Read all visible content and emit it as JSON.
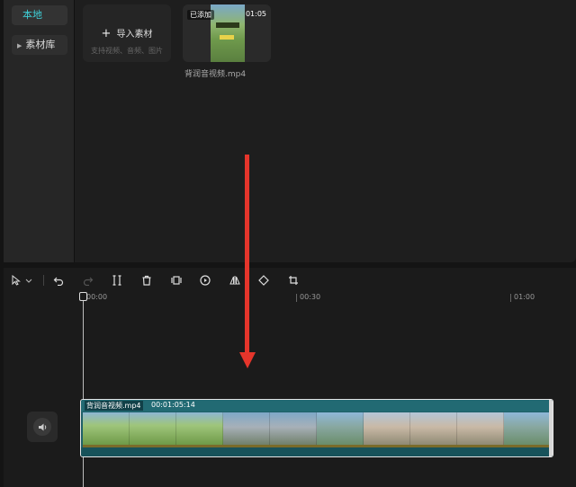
{
  "media_panel": {
    "sidebar": {
      "local_label": "本地",
      "library_label": "素材库"
    },
    "import": {
      "label": "导入素材",
      "sub": "支持视频、音频、图片"
    },
    "thumbnail": {
      "added_badge": "已添加",
      "duration": "01:05",
      "file_name": "背润音视频.mp4"
    }
  },
  "timeline": {
    "toolbar": {
      "icons": [
        "select-icon",
        "undo-icon",
        "redo-icon",
        "split-icon",
        "delete-icon",
        "freeze-icon",
        "speed-icon",
        "mirror-icon",
        "rotate-icon",
        "crop-icon"
      ]
    },
    "ruler": {
      "t0": "00:00",
      "t1": "00:30",
      "t2": "01:00"
    },
    "clip": {
      "name": "背润音视频.mp4",
      "duration": "00:01:05:14"
    }
  },
  "colors": {
    "accent": "#3fd0d8",
    "clip": "#1f6068",
    "annotation_arrow": "#e5352b"
  }
}
